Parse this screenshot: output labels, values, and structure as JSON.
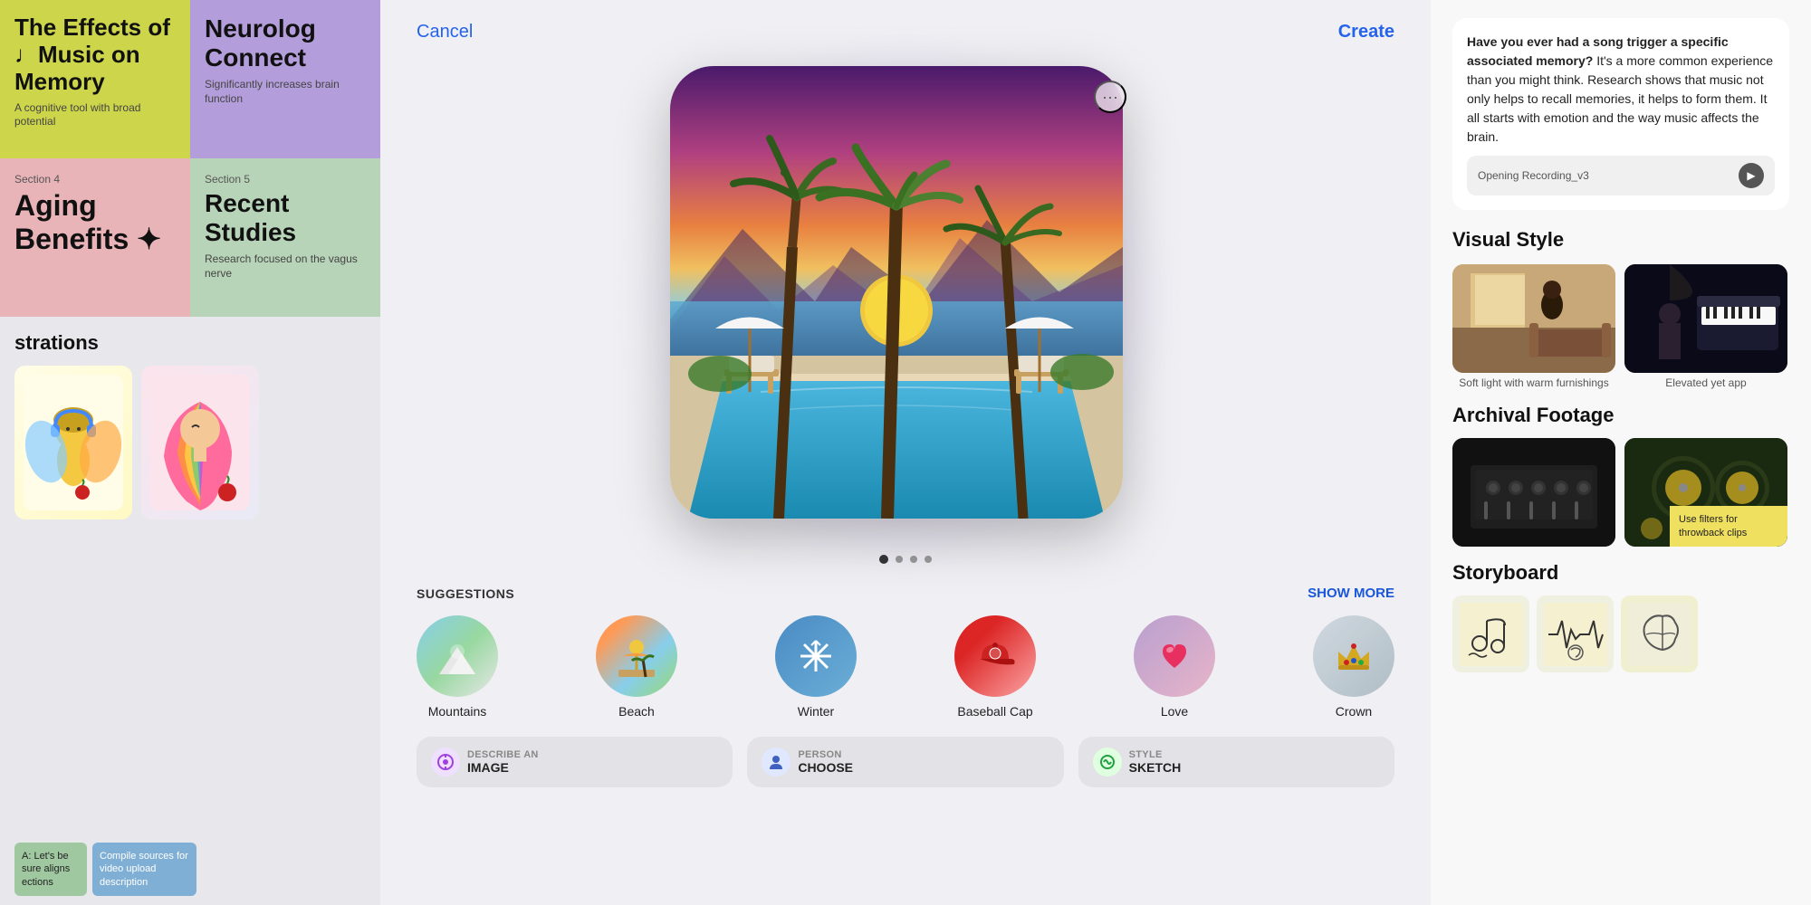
{
  "left": {
    "card1": {
      "title": "The Effects of ♩Music on Memory",
      "subtitle": "A cognitive tool with broad potential",
      "bg": "#cdd54a"
    },
    "card2": {
      "section": "",
      "title": "Neurolog Connect",
      "subtitle": "Significantly increases brain function",
      "bg": "#b39ddb"
    },
    "card3": {
      "section": "Section 4",
      "title": "Aging Benefits ✦",
      "subtitle": "",
      "bg": "#e8b4b8"
    },
    "card4": {
      "section": "Section 5",
      "title": "Recent Studies",
      "subtitle": "Research focused on the vagus nerve",
      "bg": "#b8d4b8"
    },
    "illustrations_label": "strations",
    "sticky1": "A: Let's be sure aligns ections",
    "sticky2_label": "Compile sources for video upload description",
    "sticky3_label": ""
  },
  "modal": {
    "cancel_label": "Cancel",
    "create_label": "Create",
    "more_label": "···",
    "suggestions_label": "SUGGESTIONS",
    "show_more_label": "SHOW MORE",
    "suggestions": [
      {
        "label": "Mountains",
        "icon": "mountain"
      },
      {
        "label": "Beach",
        "icon": "beach"
      },
      {
        "label": "Winter",
        "icon": "snowflake"
      },
      {
        "label": "Baseball Cap",
        "icon": "cap"
      },
      {
        "label": "Love",
        "icon": "heart"
      },
      {
        "label": "Crown",
        "icon": "crown"
      }
    ],
    "tools": [
      {
        "name": "DESCRIBE AN",
        "value": "IMAGE"
      },
      {
        "name": "PERSON",
        "value": "CHOOSE"
      },
      {
        "name": "STYLE",
        "value": "SKETCH"
      }
    ],
    "dots": [
      true,
      false,
      false,
      false
    ]
  },
  "right": {
    "audio_text_bold": "Have you ever had a song trigger a specific associated memory?",
    "audio_text_rest": " It's a more common experience than you might think. Research shows that music not only helps to recall memories, it helps to form them. It all starts with emotion and the way music affects the brain.",
    "audio_filename": "Opening Recording_v3",
    "visual_style_title": "Visual Style",
    "style1_label": "Soft light with warm furnishings",
    "style2_label": "Elevated yet app",
    "archival_title": "Archival Footage",
    "archival_overlay_text": "Use filters for throwback clips",
    "storyboard_title": "Storyboard"
  }
}
